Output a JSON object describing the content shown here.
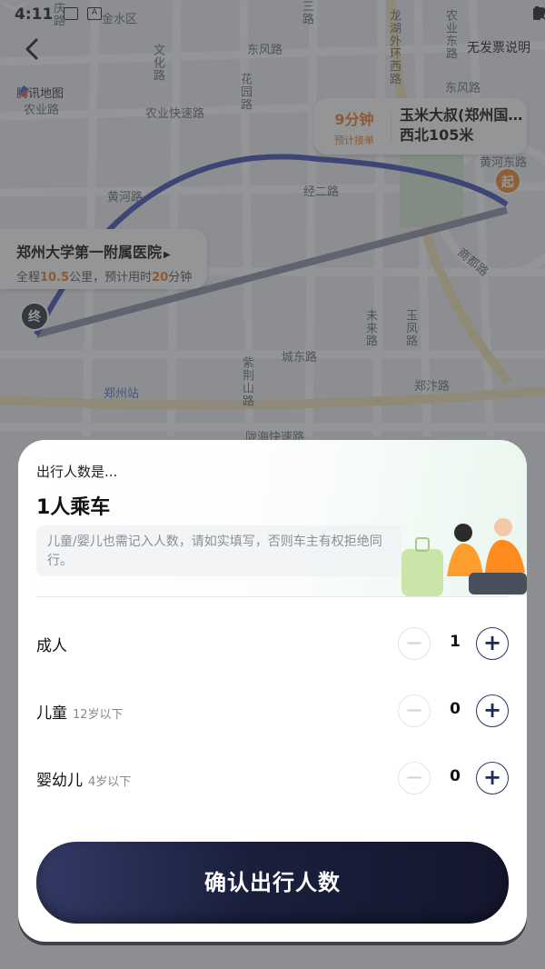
{
  "status_bar": {
    "time": "4:11"
  },
  "header": {
    "invoice_link": "无发票说明",
    "map_provider": "腾讯地图"
  },
  "map": {
    "labels": {
      "district": "金水区",
      "road_1": "庆路",
      "road_2": "三路",
      "road_3": "龙湖外环西路",
      "road_4": "东风路",
      "road_5": "文化路",
      "road_6": "花园路",
      "road_7": "农业路",
      "road_8": "农业快速路",
      "road_9": "东风路",
      "road_10": "黄河路",
      "road_11": "经二路",
      "road_12": "城东路",
      "road_13": "未来路",
      "road_14": "玉凤路",
      "road_15": "紫荆山路",
      "road_16": "郑汴路",
      "road_17": "陇海快速路",
      "station": "郑州站",
      "road_18": "农业东路",
      "road_19": "东风东路",
      "road_20": "黄河东路",
      "road_21": "商都路"
    }
  },
  "origin": {
    "eta_value": "9分钟",
    "eta_label": "预计接单",
    "name": "玉米大叔(郑州国…西北105米",
    "pin": "起"
  },
  "destination": {
    "name": "郑州大学第一附属医院",
    "summary_prefix": "全程",
    "distance": "10.5",
    "summary_middle": "公里，预计用时",
    "duration": "20",
    "summary_suffix": "分钟",
    "pin": "终"
  },
  "sheet": {
    "question": "出行人数是...",
    "count_title": "1人乘车",
    "notice": "儿童/婴儿也需记入人数，请如实填写，否则车主有权拒绝同行。",
    "rows": [
      {
        "label": "成人",
        "sub": "",
        "value": "1"
      },
      {
        "label": "儿童",
        "sub": "12岁以下",
        "value": "0"
      },
      {
        "label": "婴幼儿",
        "sub": "4岁以下",
        "value": "0"
      }
    ],
    "minus_symbol": "−",
    "plus_symbol": "+",
    "confirm_label": "确认出行人数"
  },
  "colors": {
    "accent": "#f07a22",
    "primary_dark": "#1f2a55",
    "route_blue": "#3f4fb5"
  }
}
